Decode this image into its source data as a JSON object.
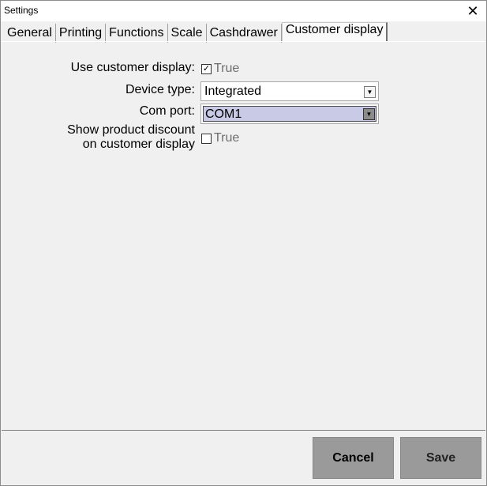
{
  "window": {
    "title": "Settings",
    "close_glyph": "✕"
  },
  "tabs": [
    {
      "label": "General",
      "active": false
    },
    {
      "label": "Printing",
      "active": false
    },
    {
      "label": "Functions",
      "active": false
    },
    {
      "label": "Scale",
      "active": false
    },
    {
      "label": "Cashdrawer",
      "active": false
    },
    {
      "label": "Customer display",
      "active": true
    }
  ],
  "form": {
    "use_customer_display": {
      "label": "Use customer display:",
      "checked": true,
      "check_glyph": "✓",
      "value_text": "True"
    },
    "device_type": {
      "label": "Device type:",
      "value": "Integrated",
      "arrow_glyph": "▼"
    },
    "com_port": {
      "label": "Com port:",
      "value": "COM1",
      "arrow_glyph": "▼"
    },
    "show_product_discount": {
      "label_line1": "Show product discount",
      "label_line2": "on customer display",
      "checked": false,
      "value_text": "True"
    }
  },
  "footer": {
    "cancel_label": "Cancel",
    "save_label": "Save"
  },
  "colors": {
    "background": "#f0f0f0",
    "button": "#9a9a9a",
    "highlight": "#c9cbe6"
  }
}
